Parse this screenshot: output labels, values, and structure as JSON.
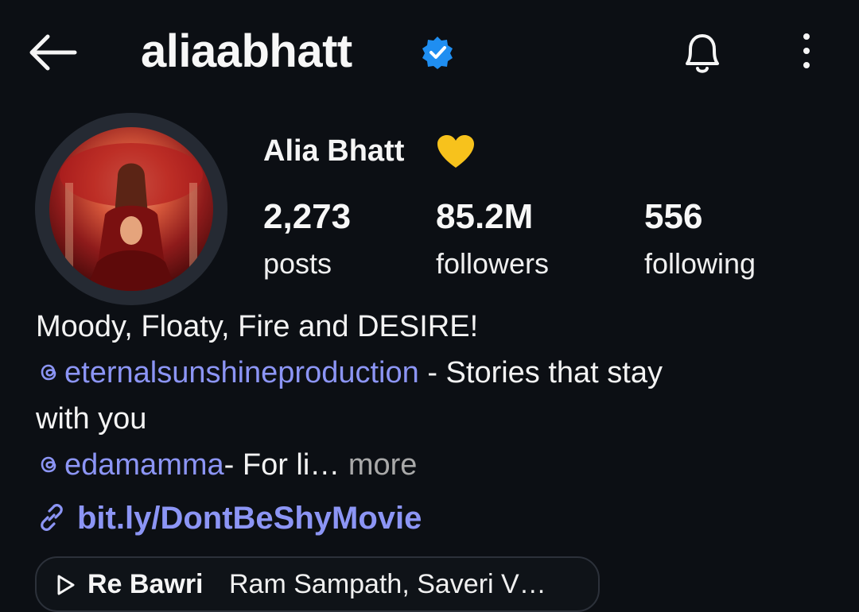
{
  "header": {
    "username": "aliaabhatt",
    "back_icon": "arrow-left-icon",
    "verified_icon": "verified-badge-icon",
    "verified_color": "#1f8ef1",
    "notification_icon": "bell-icon",
    "menu_icon": "vertical-dots-icon"
  },
  "profile": {
    "display_name": "Alia Bhatt",
    "name_emoji": "yellow-heart-icon",
    "stats": [
      {
        "value": "2,273",
        "label": "posts"
      },
      {
        "value": "85.2M",
        "label": "followers"
      },
      {
        "value": "556",
        "label": "following"
      }
    ]
  },
  "bio": {
    "line1": "Moody, Floaty, Fire and DESIRE!",
    "mention1": "eternalsunshineproduction",
    "mention1_text": " - Stories that stay",
    "line3": "with you",
    "mention2": "edamamma",
    "mention2_text": "- For li…",
    "more_label": " more",
    "mention_icon": "threads-icon",
    "link_icon": "link-icon",
    "link": "bit.ly/DontBeShyMovie"
  },
  "music": {
    "play_icon": "play-icon",
    "title": "Re Bawri",
    "artists": "Ram Sampath, Saveri V…"
  },
  "colors": {
    "background": "#0c0f14",
    "accent_link": "#8c95f5",
    "muted_text": "#a9a9a9"
  }
}
